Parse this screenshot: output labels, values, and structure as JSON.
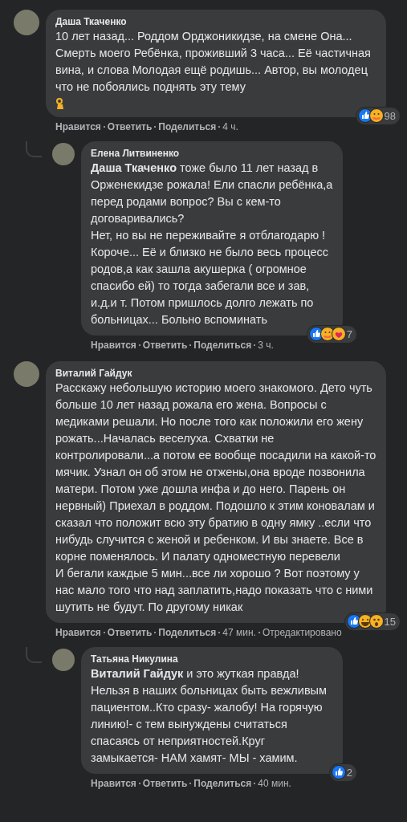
{
  "comments": [
    {
      "author": "Даша Ткаченко",
      "paragraphs": [
        "10 лет назад... Роддом Орджоникидзе, на смене Она... Смерть моего Ребёнка, проживший 3 часа... Её частичная вина, и слова Молодая ещё родишь... Автор, вы молодец что не побоялись поднять эту тему"
      ],
      "emoji_line": true,
      "reactions": [
        {
          "kind": "like"
        },
        {
          "kind": "care"
        }
      ],
      "reaction_count": "98",
      "actions": [
        "Нравится",
        "Ответить",
        "Поделиться"
      ],
      "time": "4 ч.",
      "children": [
        {
          "author": "Елена Литвиненко",
          "paragraphs": [
            "**Даша Ткаченко** тоже было 11 лет назад в Орженекидзе рожала! Ели спасли ребёнка,а перед родами вопрос? Вы с кем-то договаривались?",
            "Нет, но вы не переживайте я отблагодарю ! Короче... Её и близко не было весь процесс родов,а как зашла акушерка ( огромное спасибо ей) то тогда забегали все и зав, и.д.и т. Потом пришлось долго лежать по больницах... Больно вспоминать"
          ],
          "reactions": [
            {
              "kind": "like"
            },
            {
              "kind": "care"
            },
            {
              "kind": "love"
            }
          ],
          "reaction_count": "7",
          "actions": [
            "Нравится",
            "Ответить",
            "Поделиться"
          ],
          "time": "3 ч."
        }
      ]
    },
    {
      "author": "Виталий Гайдук",
      "paragraphs": [
        "Расскажу небольшую историю моего знакомого. Дето чуть больше 10 лет назад рожала его жена. Вопросы с медиками решали. Но после того как положили его жену рожать...Началась веселуха. Схватки не контролировали...а потом ее вообще посадили на какой-то мячик. Узнал он об этом не отжены,она вроде позвонила матери. Потом уже дошла инфа и до него. Парень он нервный) Приехал в роддом. Подошло к этим коновалам и сказал что положит всю эту братию в одну ямку ..если что нибудь случится с женой и ребенком. И вы знаете. Все в корне поменялось. И палату одноместную перевели",
        "И бегали каждые 5 мин...все ли хорошо ? Вот поэтому у нас мало того что над заплатить,надо показать что с ними шутить не будут. По другому никак"
      ],
      "reactions": [
        {
          "kind": "like"
        },
        {
          "kind": "haha"
        },
        {
          "kind": "wow"
        }
      ],
      "reaction_count": "15",
      "actions": [
        "Нравится",
        "Ответить",
        "Поделиться"
      ],
      "time": "47 мин.",
      "edited": "Отредактировано",
      "children": [
        {
          "author": "Татьяна Никулина",
          "paragraphs": [
            "**Виталий Гайдук** и это жуткая правда! Нельзя в наших больницах быть вежливым пациентом..Кто сразу- жалобу! На горячую линию!- с тем вынуждены считаться спасаясь от неприятностей.Круг замыкается- НАМ хамят- МЫ - хамим."
          ],
          "reactions": [
            {
              "kind": "like"
            }
          ],
          "reaction_count": "2",
          "actions": [
            "Нравится",
            "Ответить",
            "Поделиться"
          ],
          "time": "40 мин."
        }
      ]
    }
  ]
}
